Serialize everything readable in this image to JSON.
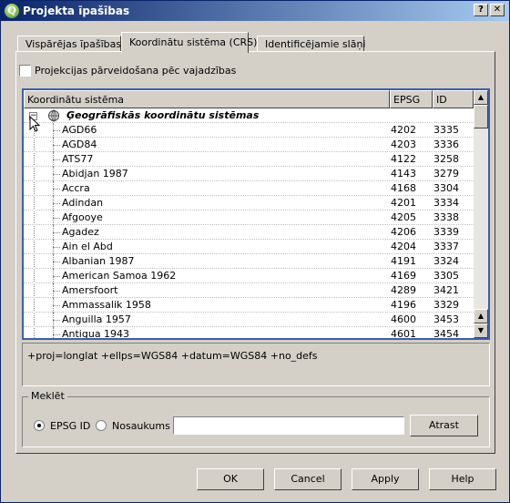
{
  "window": {
    "title": "Projekta īpašības",
    "app_icon_glyph": "Q",
    "help_glyph": "?",
    "close_glyph": "✕"
  },
  "tabs": [
    {
      "label": "Vispārējas īpašības"
    },
    {
      "label": "Koordinātu sistēma (CRS)"
    },
    {
      "label": "Identificējamie slāņi"
    }
  ],
  "reprojection_checkbox": {
    "label": "Projekcijas pārveidošana pēc vajadzības",
    "checked": false
  },
  "crs_tree": {
    "headers": [
      "Koordinātu sistēma",
      "EPSG",
      "ID"
    ],
    "group": {
      "label": "Ģeogrāfiskās koordinātu sistēmas",
      "expander": "−"
    },
    "rows": [
      {
        "name": "AGD66",
        "epsg": "4202",
        "id": "3335"
      },
      {
        "name": "AGD84",
        "epsg": "4203",
        "id": "3336"
      },
      {
        "name": "ATS77",
        "epsg": "4122",
        "id": "3258"
      },
      {
        "name": "Abidjan 1987",
        "epsg": "4143",
        "id": "3279"
      },
      {
        "name": "Accra",
        "epsg": "4168",
        "id": "3304"
      },
      {
        "name": "Adindan",
        "epsg": "4201",
        "id": "3334"
      },
      {
        "name": "Afgooye",
        "epsg": "4205",
        "id": "3338"
      },
      {
        "name": "Agadez",
        "epsg": "4206",
        "id": "3339"
      },
      {
        "name": "Ain el Abd",
        "epsg": "4204",
        "id": "3337"
      },
      {
        "name": "Albanian 1987",
        "epsg": "4191",
        "id": "3324"
      },
      {
        "name": "American Samoa 1962",
        "epsg": "4169",
        "id": "3305"
      },
      {
        "name": "Amersfoort",
        "epsg": "4289",
        "id": "3421"
      },
      {
        "name": "Ammassalik 1958",
        "epsg": "4196",
        "id": "3329"
      },
      {
        "name": "Anguilla 1957",
        "epsg": "4600",
        "id": "3453"
      },
      {
        "name": "Antigua 1943",
        "epsg": "4601",
        "id": "3454"
      }
    ],
    "scroll_up_glyph": "▲",
    "scroll_down_glyph": "▼",
    "scroll_end_up_glyph": "▲",
    "scroll_end_down_glyph": "▼"
  },
  "projection_string": "+proj=longlat +ellps=WGS84 +datum=WGS84 +no_defs",
  "search": {
    "group_title": "Meklēt",
    "radio_epsg": "EPSG ID",
    "radio_name": "Nosaukums",
    "selected": "EPSG ID",
    "input_value": "",
    "find_button": "Atrast"
  },
  "buttons": {
    "ok": "OK",
    "cancel": "Cancel",
    "apply": "Apply",
    "help": "Help"
  },
  "colors": {
    "tree_focus_border": "#3c5fa8",
    "titlebar_start": "#0a246a",
    "titlebar_end": "#a6caf0"
  }
}
